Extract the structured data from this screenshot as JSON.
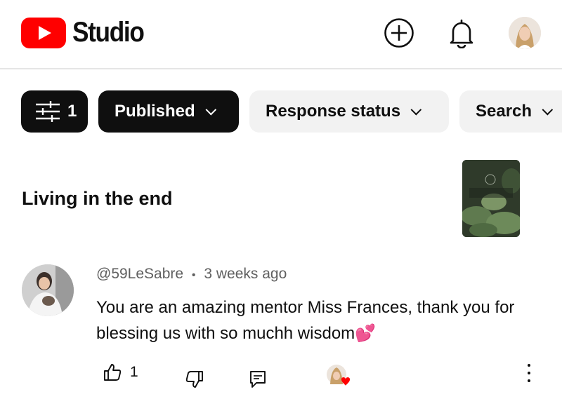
{
  "header": {
    "logo_text": "Studio",
    "icons": [
      "create-icon",
      "bell-icon",
      "avatar"
    ],
    "brand_color": "#ff0000"
  },
  "filters": {
    "filter_count": "1",
    "chips": [
      {
        "label": "Published",
        "selected": true
      },
      {
        "label": "Response status",
        "selected": false
      },
      {
        "label": "Search",
        "selected": false
      }
    ]
  },
  "video": {
    "title": "Living in the end"
  },
  "comment": {
    "author": "@59LeSabre",
    "separator": "•",
    "time": "3 weeks ago",
    "text": "You are an amazing mentor Miss Frances, thank you for blessing us with so muchh wisdom💕",
    "like_count": "1",
    "creator_heart": true
  }
}
